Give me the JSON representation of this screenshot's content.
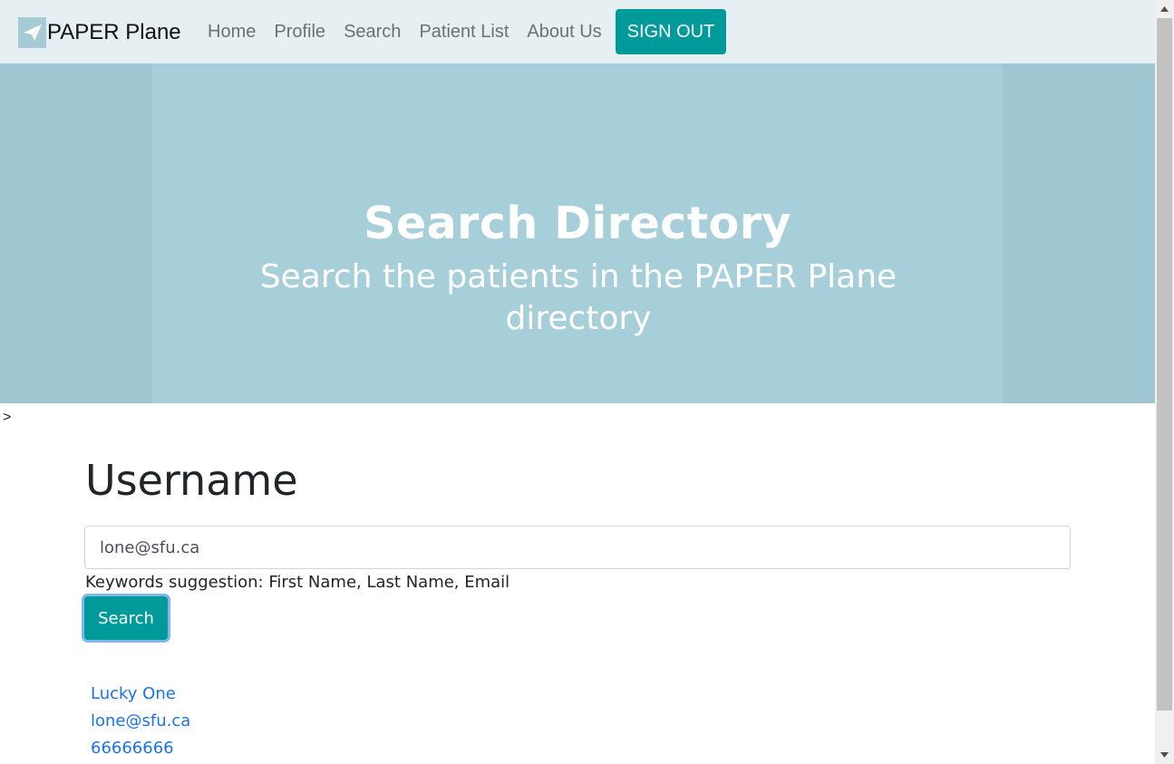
{
  "nav": {
    "brand": "PAPER Plane",
    "brand_icon": "paper-plane-icon",
    "links": [
      "Home",
      "Profile",
      "Search",
      "Patient List",
      "About Us"
    ],
    "signout": "SIGN OUT"
  },
  "hero": {
    "title": "Search Directory",
    "subtitle": "Search the patients in the PAPER Plane directory"
  },
  "stray_text": ">",
  "form": {
    "heading": "Username",
    "input_value": "lone@sfu.ca",
    "hint": "Keywords suggestion: First Name, Last Name, Email",
    "button": "Search"
  },
  "results": [
    "Lucky One",
    "lone@sfu.ca",
    "66666666"
  ],
  "colors": {
    "accent": "#009a9a",
    "nav_bg": "#e6eff2",
    "hero_bg": "#a7cfd9",
    "link": "#1a73e8"
  }
}
